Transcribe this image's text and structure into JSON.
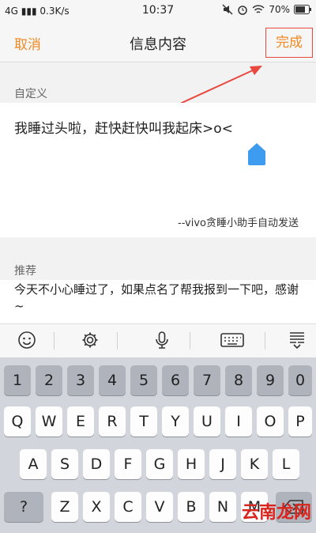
{
  "status": {
    "network": "4G",
    "speed": "0.3K/s",
    "time": "10:37",
    "battery": "70%"
  },
  "nav": {
    "cancel": "取消",
    "title": "信息内容",
    "done": "完成"
  },
  "custom": {
    "label": "自定义",
    "text": "我睡过头啦，赶快赶快叫我起床>o<",
    "signature": "--vivo贪睡小助手自动发送"
  },
  "recommend": {
    "label": "推荐",
    "text": "今天不小心睡过了，如果点名了帮我报到一下吧，感谢~"
  },
  "toolbar": {
    "icons": [
      "emoji-icon",
      "gear-icon",
      "microphone-icon",
      "keyboard-icon",
      "collapse-keyboard-icon"
    ]
  },
  "keyboard": {
    "numbers": [
      "1",
      "2",
      "3",
      "4",
      "5",
      "6",
      "7",
      "8",
      "9",
      "0"
    ],
    "row1": [
      "Q",
      "W",
      "E",
      "R",
      "T",
      "Y",
      "U",
      "I",
      "O",
      "P"
    ],
    "row2": [
      "A",
      "S",
      "D",
      "F",
      "G",
      "H",
      "J",
      "K",
      "L"
    ],
    "row3": [
      "Z",
      "X",
      "C",
      "V",
      "B",
      "N",
      "M"
    ],
    "special": {
      "symbols": "?"
    }
  },
  "watermark": "云南龙网",
  "colors": {
    "accent": "#f08a24",
    "highlight": "#e8493f",
    "drop": "#3d9bf0"
  }
}
